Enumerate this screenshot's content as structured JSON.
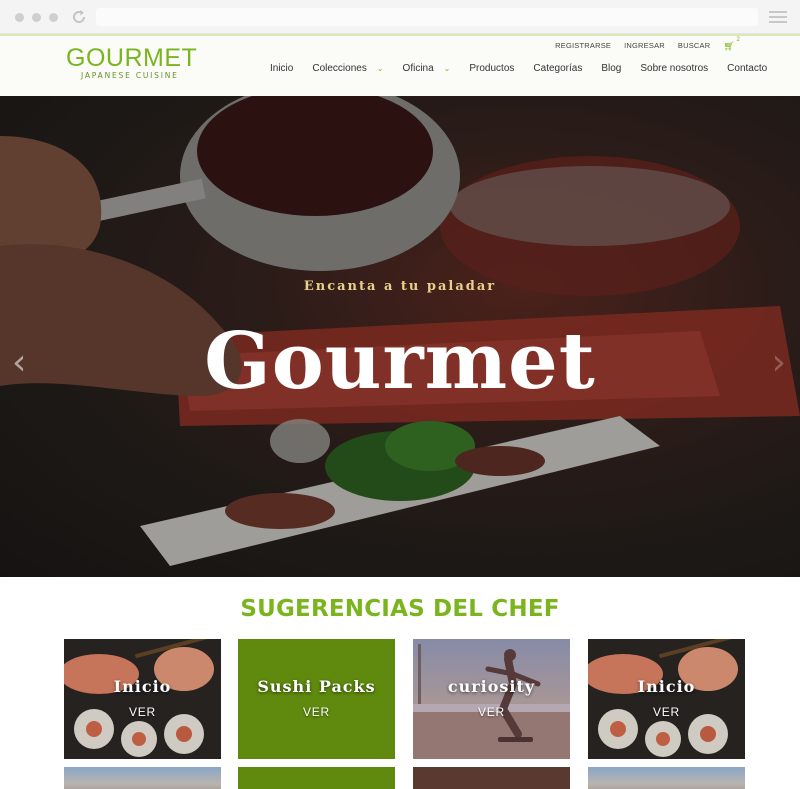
{
  "header": {
    "logo_title": "GOURMET",
    "logo_subtitle": "JAPANESE CUISINE",
    "top_links": [
      "REGISTRARSE",
      "INGRESAR",
      "BUSCAR"
    ],
    "cart_count": "2",
    "nav": [
      {
        "label": "Inicio",
        "has_dropdown": false
      },
      {
        "label": "Colecciones",
        "has_dropdown": true
      },
      {
        "label": "Oficina",
        "has_dropdown": true
      },
      {
        "label": "Productos",
        "has_dropdown": false
      },
      {
        "label": "Categorías",
        "has_dropdown": false
      },
      {
        "label": "Blog",
        "has_dropdown": false
      },
      {
        "label": "Sobre nosotros",
        "has_dropdown": false
      },
      {
        "label": "Contacto",
        "has_dropdown": false
      }
    ]
  },
  "hero": {
    "tagline": "Encanta a tu paladar",
    "title": "Gourmet"
  },
  "section": {
    "title": "SUGERENCIAS DEL CHEF"
  },
  "cards": [
    {
      "title": "Inicio",
      "action": "VER",
      "image": "sushi"
    },
    {
      "title": "Sushi Packs",
      "action": "VER",
      "image": "green"
    },
    {
      "title": "curiosity",
      "action": "VER",
      "image": "beach"
    },
    {
      "title": "Inicio",
      "action": "VER",
      "image": "sushi"
    }
  ],
  "colors": {
    "brand_green": "#7ab51d",
    "card_green": "#5f8a0e",
    "tagline_gold": "#e9cf8c"
  }
}
